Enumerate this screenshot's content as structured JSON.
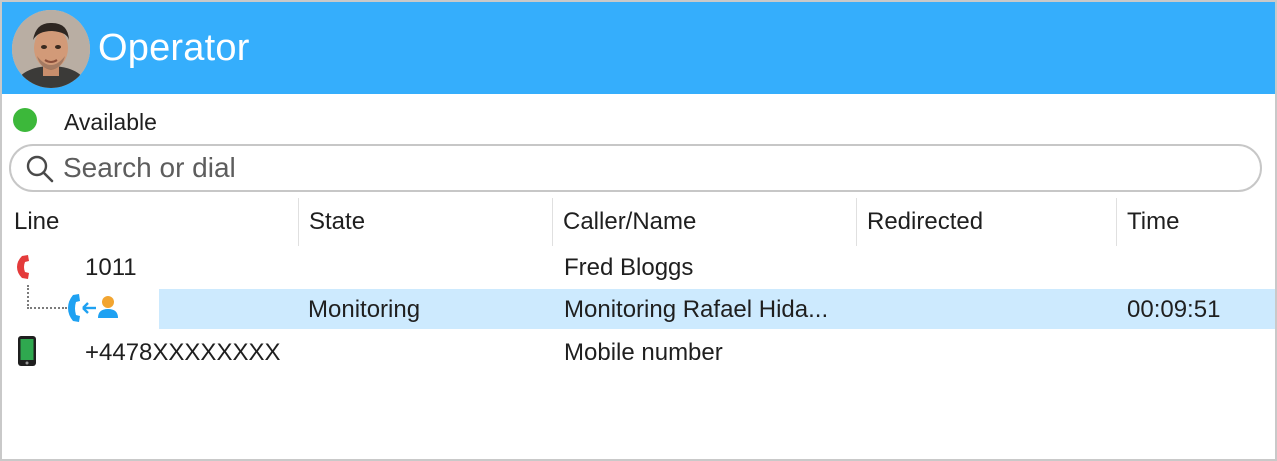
{
  "header": {
    "title": "Operator",
    "background_color": "#35aefc"
  },
  "status": {
    "label": "Available",
    "color": "#3cb83a"
  },
  "search": {
    "placeholder": "Search or dial"
  },
  "table": {
    "columns": [
      "Line",
      "State",
      "Caller/Name",
      "Redirected",
      "Time"
    ],
    "rows": [
      {
        "line_icon": "desk-phone-handset-icon",
        "line": "1011",
        "state": "",
        "caller": "Fred Bloggs",
        "redirected": "",
        "time": ""
      },
      {
        "line_icon": "monitor-call-icon",
        "line": "",
        "state": "Monitoring",
        "caller": "Monitoring Rafael Hida...",
        "redirected": "",
        "time": "00:09:51",
        "selected": true
      },
      {
        "line_icon": "mobile-phone-icon",
        "line": "+4478XXXXXXXX",
        "state": "",
        "caller": "Mobile number",
        "redirected": "",
        "time": ""
      }
    ]
  },
  "colors": {
    "selected_row": "#cdeafe",
    "handset_red": "#e43b3b",
    "monitor_blue": "#1ea1f2",
    "mobile_green": "#2fa84f"
  }
}
